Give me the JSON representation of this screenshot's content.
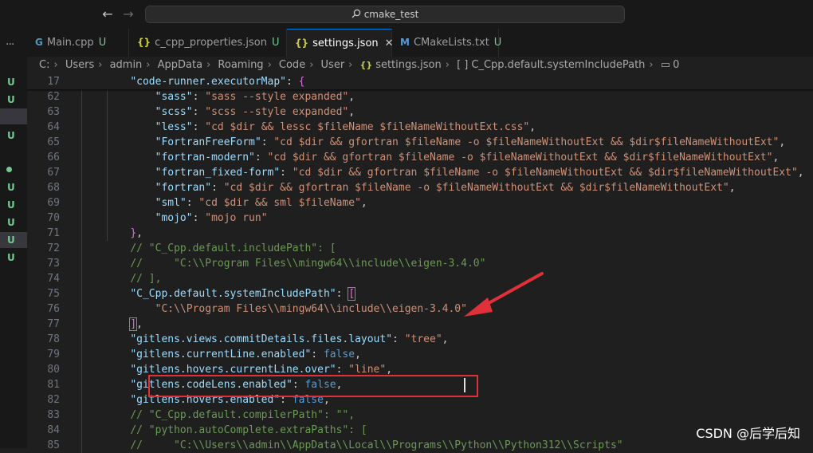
{
  "window": {
    "search_text": "cmake_test"
  },
  "activity": {
    "menu_icon": "ellipsis-icon",
    "marks": [
      "U",
      "U",
      "U",
      "U",
      "U",
      "U",
      "U",
      "U"
    ]
  },
  "tabs": [
    {
      "label": "Main.cpp",
      "icon": "cpp-file-icon",
      "status": "U",
      "active": false
    },
    {
      "label": "c_cpp_properties.json",
      "icon": "json-braces-icon",
      "status": "U",
      "active": false
    },
    {
      "label": "settings.json",
      "icon": "json-braces-icon",
      "status": "",
      "active": true
    },
    {
      "label": "CMakeLists.txt",
      "icon": "cmake-m-icon",
      "status": "U",
      "active": false
    }
  ],
  "breadcrumb": {
    "parts": [
      "C:",
      "Users",
      "admin",
      "AppData",
      "Roaming",
      "Code",
      "User",
      "settings.json",
      "C_Cpp.default.systemIncludePath",
      "0"
    ],
    "file_icon_glyph": "{}",
    "array_icon_glyph": "[ ]",
    "count_icon_glyph": "▭"
  },
  "editor": {
    "lines": [
      {
        "n": "17",
        "code": "    \"code-runner.executorMap\": {"
      },
      {
        "n": "62",
        "code": "        \"sass\": \"sass --style expanded\","
      },
      {
        "n": "63",
        "code": "        \"scss\": \"scss --style expanded\","
      },
      {
        "n": "64",
        "code": "        \"less\": \"cd $dir && lessc $fileName $fileNameWithoutExt.css\","
      },
      {
        "n": "65",
        "code": "        \"FortranFreeForm\": \"cd $dir && gfortran $fileName -o $fileNameWithoutExt && $dir$fileNameWithoutExt\","
      },
      {
        "n": "66",
        "code": "        \"fortran-modern\": \"cd $dir && gfortran $fileName -o $fileNameWithoutExt && $dir$fileNameWithoutExt\","
      },
      {
        "n": "67",
        "code": "        \"fortran_fixed-form\": \"cd $dir && gfortran $fileName -o $fileNameWithoutExt && $dir$fileNameWithoutExt\","
      },
      {
        "n": "68",
        "code": "        \"fortran\": \"cd $dir && gfortran $fileName -o $fileNameWithoutExt && $dir$fileNameWithoutExt\","
      },
      {
        "n": "69",
        "code": "        \"sml\": \"cd $dir && sml $fileName\","
      },
      {
        "n": "70",
        "code": "        \"mojo\": \"mojo run\""
      },
      {
        "n": "71",
        "code": "    },"
      },
      {
        "n": "72",
        "code": "    // \"C_Cpp.default.includePath\": ["
      },
      {
        "n": "73",
        "code": "    //     \"C:\\\\Program Files\\\\mingw64\\\\include\\\\eigen-3.4.0\""
      },
      {
        "n": "74",
        "code": "    // ],"
      },
      {
        "n": "75",
        "code": "    \"C_Cpp.default.systemIncludePath\": ["
      },
      {
        "n": "76",
        "code": "        \"C:\\\\Program Files\\\\mingw64\\\\include\\\\eigen-3.4.0\""
      },
      {
        "n": "77",
        "code": "    ],"
      },
      {
        "n": "78",
        "code": "    \"gitlens.views.commitDetails.files.layout\": \"tree\","
      },
      {
        "n": "79",
        "code": "    \"gitlens.currentLine.enabled\": false,"
      },
      {
        "n": "80",
        "code": "    \"gitlens.hovers.currentLine.over\": \"line\","
      },
      {
        "n": "81",
        "code": "    \"gitlens.codeLens.enabled\": false,"
      },
      {
        "n": "82",
        "code": "    \"gitlens.hovers.enabled\": false,"
      },
      {
        "n": "83",
        "code": "    // \"C_Cpp.default.compilerPath\": \"\","
      },
      {
        "n": "84",
        "code": "    // \"python.autoComplete.extraPaths\": ["
      },
      {
        "n": "85",
        "code": "    //     \"C:\\\\Users\\\\admin\\\\AppData\\\\Local\\\\Programs\\\\Python\\\\Python312\\\\Scripts\""
      }
    ]
  },
  "annotation": {
    "color": "#e0303a"
  },
  "watermark": "CSDN @后学后知"
}
